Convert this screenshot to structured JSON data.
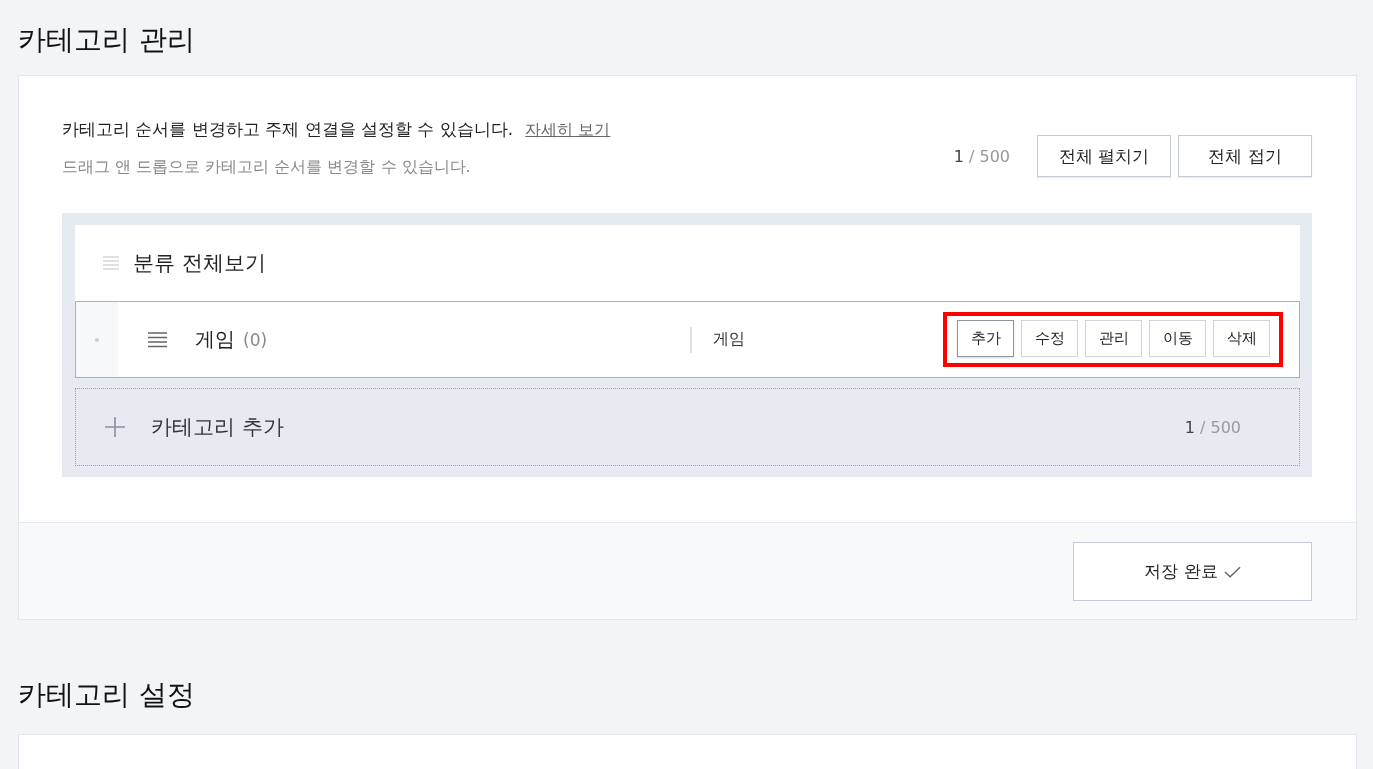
{
  "category_management": {
    "title": "카테고리 관리",
    "description": "카테고리 순서를 변경하고 주제 연결을 설정할 수 있습니다.",
    "help_link": "자세히 보기",
    "hint": "드래그 앤 드롭으로 카테고리 순서를 변경할 수 있습니다.",
    "counter": {
      "current": "1",
      "limit": "/ 500"
    },
    "toolbar_buttons": [
      "전체 펼치기",
      "전체 접기"
    ],
    "tree": {
      "root": {
        "label": "분류 전체보기",
        "draggable": false
      },
      "categories": [
        {
          "name": "게임",
          "count": "(0)",
          "topic": "게임",
          "selected": true,
          "draggable": true,
          "actions_highlighted": true,
          "actions": [
            {
              "label": "추가",
              "focused": true
            },
            {
              "label": "수정",
              "focused": false
            },
            {
              "label": "관리",
              "focused": false
            },
            {
              "label": "이동",
              "focused": false
            },
            {
              "label": "삭제",
              "focused": false
            }
          ]
        }
      ]
    },
    "add_row": {
      "label": "카테고리 추가",
      "counter": {
        "current": "1",
        "limit": "/ 500"
      }
    },
    "save_button": {
      "label": "저장 완료"
    }
  },
  "category_settings": {
    "title": "카테고리 설정"
  }
}
